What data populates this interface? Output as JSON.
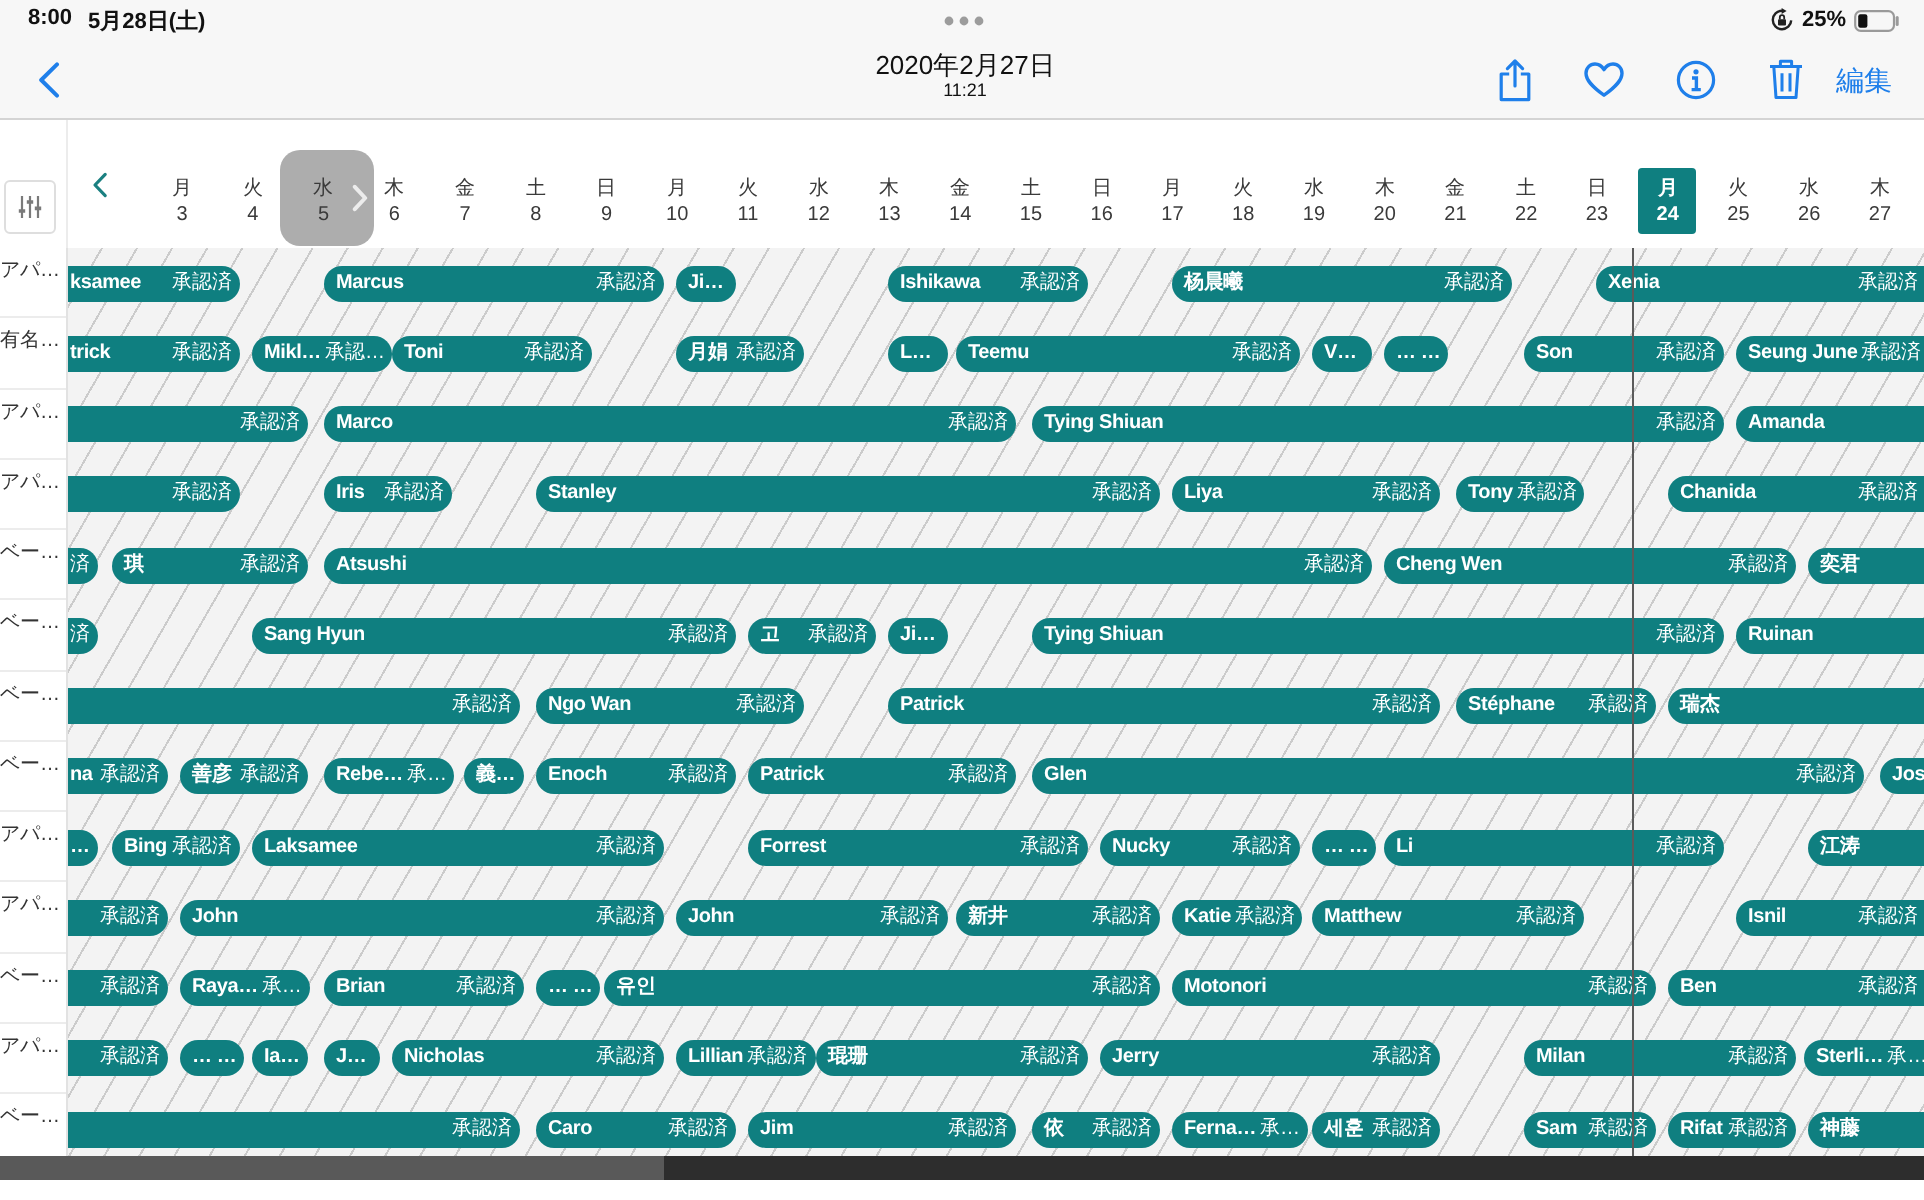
{
  "status_bar": {
    "time": "8:00",
    "date": "5月28日(土)",
    "battery": "25%"
  },
  "nav_bar": {
    "title": "2020年2月27日",
    "subtitle": "11:21",
    "edit_label": "編集"
  },
  "schedule": {
    "days": [
      {
        "weekday": "月",
        "day": "3",
        "selected": false
      },
      {
        "weekday": "火",
        "day": "4",
        "selected": false
      },
      {
        "weekday": "水",
        "day": "5",
        "selected": false
      },
      {
        "weekday": "木",
        "day": "6",
        "selected": false
      },
      {
        "weekday": "金",
        "day": "7",
        "selected": false
      },
      {
        "weekday": "土",
        "day": "8",
        "selected": false
      },
      {
        "weekday": "日",
        "day": "9",
        "selected": false
      },
      {
        "weekday": "月",
        "day": "10",
        "selected": false
      },
      {
        "weekday": "火",
        "day": "11",
        "selected": false
      },
      {
        "weekday": "水",
        "day": "12",
        "selected": false
      },
      {
        "weekday": "木",
        "day": "13",
        "selected": false
      },
      {
        "weekday": "金",
        "day": "14",
        "selected": false
      },
      {
        "weekday": "土",
        "day": "15",
        "selected": false
      },
      {
        "weekday": "日",
        "day": "16",
        "selected": false
      },
      {
        "weekday": "月",
        "day": "17",
        "selected": false
      },
      {
        "weekday": "火",
        "day": "18",
        "selected": false
      },
      {
        "weekday": "水",
        "day": "19",
        "selected": false
      },
      {
        "weekday": "木",
        "day": "20",
        "selected": false
      },
      {
        "weekday": "金",
        "day": "21",
        "selected": false
      },
      {
        "weekday": "土",
        "day": "22",
        "selected": false
      },
      {
        "weekday": "日",
        "day": "23",
        "selected": false
      },
      {
        "weekday": "月",
        "day": "24",
        "selected": true
      },
      {
        "weekday": "火",
        "day": "25",
        "selected": false
      },
      {
        "weekday": "水",
        "day": "26",
        "selected": false
      },
      {
        "weekday": "木",
        "day": "27",
        "selected": false
      }
    ],
    "rows": [
      {
        "label": "アパ…",
        "shifts": [
          {
            "name": "ksamee",
            "status": "承認済"
          },
          {
            "name": "Marcus",
            "status": "承認済"
          },
          {
            "name": "Ji…"
          },
          {
            "name": "Ishikawa",
            "status": "承認済"
          },
          {
            "name": "杨晨曦",
            "status": "承認済"
          },
          {
            "name": "Xenia",
            "status": "承認済"
          }
        ]
      },
      {
        "label": "有名…",
        "shifts": [
          {
            "name": "trick",
            "status": "承認済"
          },
          {
            "name": "Mikl…",
            "status": "承認…"
          },
          {
            "name": "Toni",
            "status": "承認済"
          },
          {
            "name": "月娟",
            "status": "承認済"
          },
          {
            "name": "L…"
          },
          {
            "name": "Teemu",
            "status": "承認済"
          },
          {
            "name": "V…"
          },
          {
            "name": "… …"
          },
          {
            "name": "Son",
            "status": "承認済"
          },
          {
            "name": "Seung June",
            "status": "承認済"
          }
        ]
      },
      {
        "label": "アパ…",
        "shifts": [
          {
            "status": "承認済"
          },
          {
            "name": "Marco",
            "status": "承認済"
          },
          {
            "name": "Tying Shiuan",
            "status": "承認済"
          },
          {
            "name": "Amanda"
          }
        ]
      },
      {
        "label": "アパ…",
        "shifts": [
          {
            "status": "承認済"
          },
          {
            "name": "Iris",
            "status": "承認済"
          },
          {
            "name": "Stanley",
            "status": "承認済"
          },
          {
            "name": "Liya",
            "status": "承認済"
          },
          {
            "name": "Tony",
            "status": "承認済"
          },
          {
            "name": "Chanida",
            "status": "承認済"
          }
        ]
      },
      {
        "label": "ベー…",
        "shifts": [
          {
            "status": "済"
          },
          {
            "name": "琪",
            "status": "承認済"
          },
          {
            "name": "Atsushi",
            "status": "承認済"
          },
          {
            "name": "Cheng Wen",
            "status": "承認済"
          },
          {
            "name": "奕君"
          }
        ]
      },
      {
        "label": "ベー…",
        "shifts": [
          {
            "status": "済"
          },
          {
            "name": "Sang Hyun",
            "status": "承認済"
          },
          {
            "name": "고",
            "status": "承認済"
          },
          {
            "name": "Ji…"
          },
          {
            "name": "Tying Shiuan",
            "status": "承認済"
          },
          {
            "name": "Ruinan"
          }
        ]
      },
      {
        "label": "ベー…",
        "shifts": [
          {
            "status": "承認済"
          },
          {
            "name": "Ngo Wan",
            "status": "承認済"
          },
          {
            "name": "Patrick",
            "status": "承認済"
          },
          {
            "name": "Stéphane",
            "status": "承認済"
          },
          {
            "name": "瑞杰"
          }
        ]
      },
      {
        "label": "ベー…",
        "shifts": [
          {
            "name": "na",
            "status": "承認済"
          },
          {
            "name": "善彦",
            "status": "承認済"
          },
          {
            "name": "Rebe…",
            "status": "承…"
          },
          {
            "name": "義…"
          },
          {
            "name": "Enoch",
            "status": "承認済"
          },
          {
            "name": "Patrick",
            "status": "承認済"
          },
          {
            "name": "Glen",
            "status": "承認済"
          },
          {
            "name": "Jos"
          }
        ]
      },
      {
        "label": "アパ…",
        "shifts": [
          {
            "name": "…"
          },
          {
            "name": "Bing",
            "status": "承認済"
          },
          {
            "name": "Laksamee",
            "status": "承認済"
          },
          {
            "name": "Forrest",
            "status": "承認済"
          },
          {
            "name": "Nucky",
            "status": "承認済"
          },
          {
            "name": "… …"
          },
          {
            "name": "Li",
            "status": "承認済"
          },
          {
            "name": "江涛"
          }
        ]
      },
      {
        "label": "アパ…",
        "shifts": [
          {
            "status": "承認済"
          },
          {
            "name": "John",
            "status": "承認済"
          },
          {
            "name": "John",
            "status": "承認済"
          },
          {
            "name": "新井",
            "status": "承認済"
          },
          {
            "name": "Katie",
            "status": "承認済"
          },
          {
            "name": "Matthew",
            "status": "承認済"
          },
          {
            "name": "Isnil",
            "status": "承認済"
          }
        ]
      },
      {
        "label": "ベー…",
        "shifts": [
          {
            "status": "承認済"
          },
          {
            "name": "Raya…",
            "status": "承…"
          },
          {
            "name": "Brian",
            "status": "承認済"
          },
          {
            "name": "… …"
          },
          {
            "name": "유인",
            "status": "承認済"
          },
          {
            "name": "Motonori",
            "status": "承認済"
          },
          {
            "name": "Ben",
            "status": "承認済"
          }
        ]
      },
      {
        "label": "アパ…",
        "shifts": [
          {
            "status": "承認済"
          },
          {
            "name": "… …"
          },
          {
            "name": "Ia…"
          },
          {
            "name": "J…"
          },
          {
            "name": "Nicholas",
            "status": "承認済"
          },
          {
            "name": "Lillian",
            "status": "承認済"
          },
          {
            "name": "琨珊",
            "status": "承認済"
          },
          {
            "name": "Jerry",
            "status": "承認済"
          },
          {
            "name": "Milan",
            "status": "承認済"
          },
          {
            "name": "Sterli…",
            "status": "承…"
          }
        ]
      },
      {
        "label": "ベー…",
        "shifts": [
          {
            "status": "承認済"
          },
          {
            "name": "Caro",
            "status": "承認済"
          },
          {
            "name": "Jim",
            "status": "承認済"
          },
          {
            "name": "依",
            "status": "承認済"
          },
          {
            "name": "Ferna…",
            "status": "承…"
          },
          {
            "name": "세훈",
            "status": "承認済"
          },
          {
            "name": "Sam",
            "status": "承認済"
          },
          {
            "name": "Rifat",
            "status": "承認済"
          },
          {
            "name": "神藤"
          }
        ]
      }
    ]
  }
}
